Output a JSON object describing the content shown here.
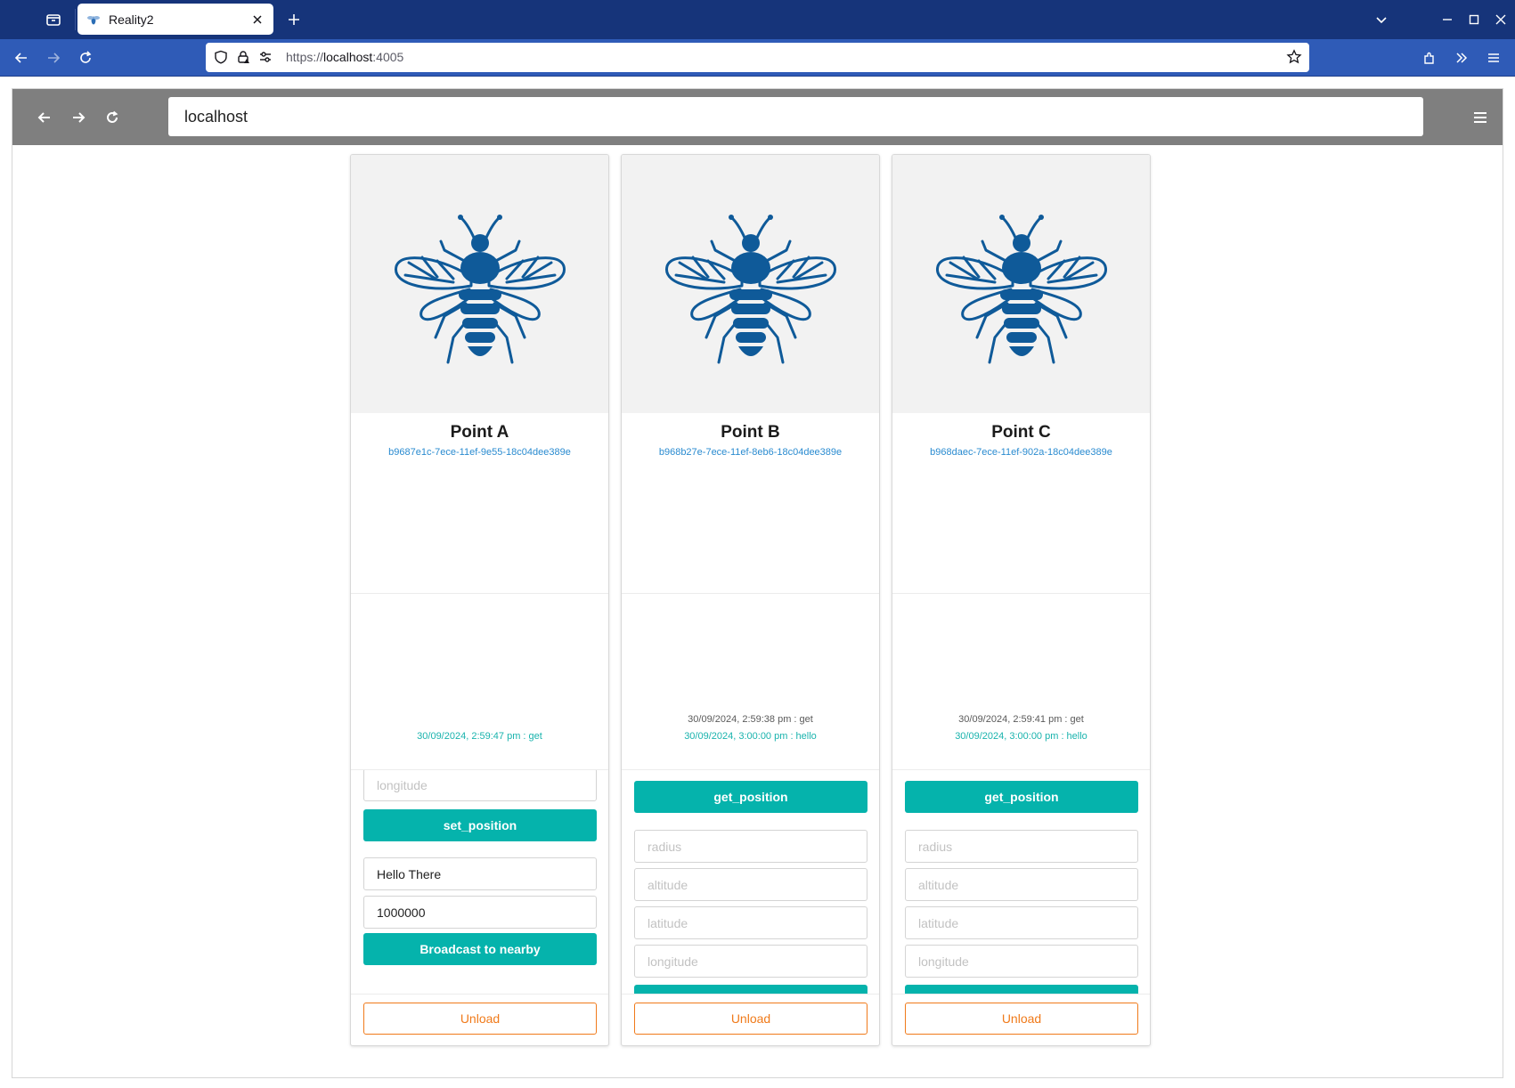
{
  "browser": {
    "tab_title": "Reality2",
    "url_scheme": "https://",
    "url_host": "localhost",
    "url_port": ":4005"
  },
  "app": {
    "address_value": "localhost"
  },
  "cards": [
    {
      "name": "Point A",
      "id": "b9687e1c-7ece-11ef-9e55-18c04dee389e",
      "log_get": "",
      "log_last": "30/09/2024, 2:59:47 pm : get",
      "longitude_placeholder": "longitude",
      "set_position_label": "set_position",
      "message_value": "Hello There",
      "distance_value": "1000000",
      "broadcast_label": "Broadcast to nearby",
      "unload_label": "Unload"
    },
    {
      "name": "Point B",
      "id": "b968b27e-7ece-11ef-8eb6-18c04dee389e",
      "log_get": "30/09/2024, 2:59:38 pm : get",
      "log_last": "30/09/2024, 3:00:00 pm : hello",
      "get_position_label": "get_position",
      "radius_placeholder": "radius",
      "altitude_placeholder": "altitude",
      "latitude_placeholder": "latitude",
      "longitude_placeholder": "longitude",
      "unload_label": "Unload"
    },
    {
      "name": "Point C",
      "id": "b968daec-7ece-11ef-902a-18c04dee389e",
      "log_get": "30/09/2024, 2:59:41 pm : get",
      "log_last": "30/09/2024, 3:00:00 pm : hello",
      "get_position_label": "get_position",
      "radius_placeholder": "radius",
      "altitude_placeholder": "altitude",
      "latitude_placeholder": "latitude",
      "longitude_placeholder": "longitude",
      "unload_label": "Unload"
    }
  ],
  "icons": {
    "card_image": "bee-icon",
    "brand_color": "#0f5a99",
    "accent_color": "#05b3ac",
    "unload_color": "#f07a1a"
  }
}
